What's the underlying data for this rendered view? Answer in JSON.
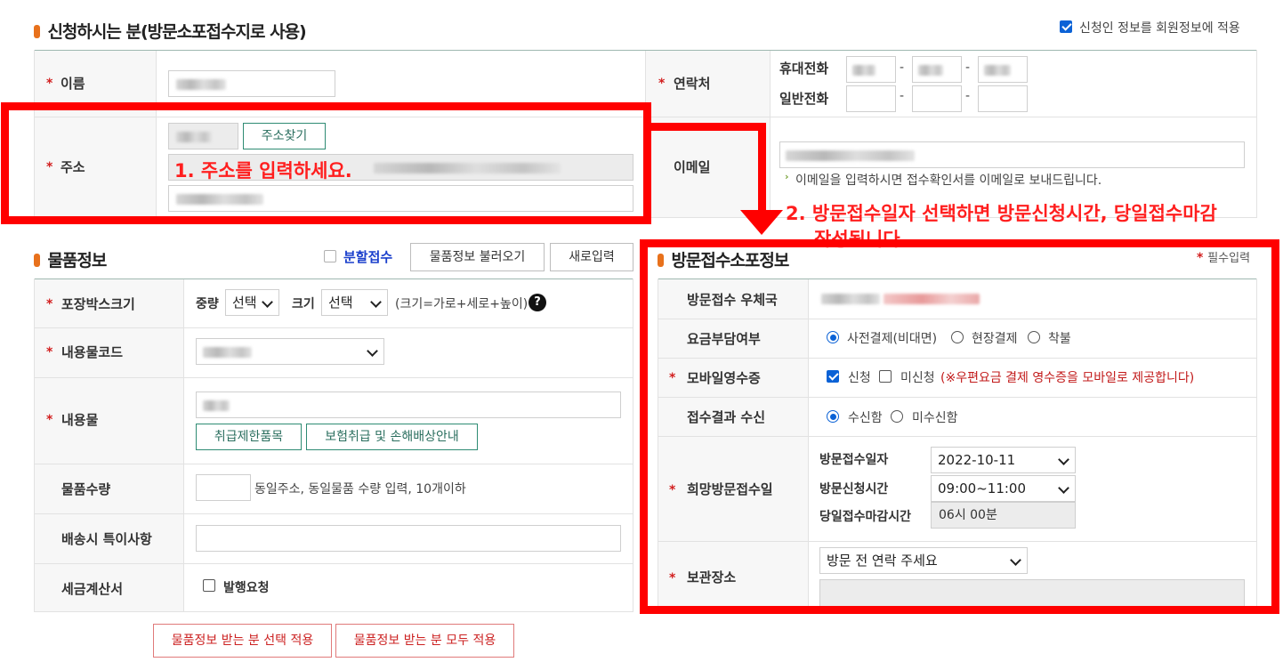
{
  "applicant": {
    "title": "신청하시는 분(방문소포접수지로 사용)",
    "apply_member_label": "신청인 정보를 회원정보에 적용",
    "name_label": "이름",
    "contact_label": "연락처",
    "mobile_label": "휴대전화",
    "phone_label": "일반전화",
    "address_label": "주소",
    "address_search_btn": "주소찾기",
    "email_label": "이메일",
    "email_note": "이메일을 입력하시면 접수확인서를 이메일로 보내드립니다.",
    "dash": "-"
  },
  "goods": {
    "title": "물품정보",
    "split_label": "분할접수",
    "load_btn": "물품정보 불러오기",
    "new_btn": "새로입력",
    "box_label": "포장박스크기",
    "weight_label": "중량",
    "weight_value": "선택",
    "size_label": "크기",
    "size_value": "선택",
    "size_hint": "(크기=가로+세로+높이)",
    "help_icon": "?",
    "code_label": "내용물코드",
    "content_label": "내용물",
    "restricted_btn": "취급제한품목",
    "insurance_btn": "보험취급 및 손해배상안내",
    "qty_label": "물품수량",
    "qty_hint": "동일주소, 동일물품 수량 입력, 10개이하",
    "special_label": "배송시 특이사항",
    "tax_label": "세금계산서",
    "tax_check_label": "발행요청",
    "apply_select_btn": "물품정보 받는 분 선택 적용",
    "apply_all_btn": "물품정보 받는 분 모두 적용"
  },
  "visit": {
    "title": "방문접수소포정보",
    "required_note": "필수입력",
    "office_label": "방문접수 우체국",
    "fee_label": "요금부담여부",
    "fee_options": [
      "사전결제(비대면)",
      "현장결제",
      "착불"
    ],
    "receipt_label": "모바일영수증",
    "receipt_yes": "신청",
    "receipt_no": "미신청",
    "receipt_note": "(※우편요금 결제 영수증을 모바일로 제공합니다)",
    "result_label": "접수결과 수신",
    "result_yes": "수신함",
    "result_no": "미수신함",
    "wish_label": "희망방문접수일",
    "date_label": "방문접수일자",
    "date_value": "2022-10-11",
    "time_label": "방문신청시간",
    "time_value": "09:00~11:00",
    "deadline_label": "당일접수마감시간",
    "deadline_value": "06시 00분",
    "storage_label": "보관장소",
    "storage_value": "방문 전 연락 주세요"
  },
  "annotations": {
    "step1": "1. 주소를 입력하세요.",
    "step2_line1": "2. 방문접수일자 선택하면 방문신청시간, 당일접수마감",
    "step2_line2": "작성됩니다"
  },
  "colors": {
    "annotation_red": "#ff0000",
    "accent_orange": "#e8711c",
    "button_green": "#2e8b73",
    "required_red": "#d21e1e"
  }
}
